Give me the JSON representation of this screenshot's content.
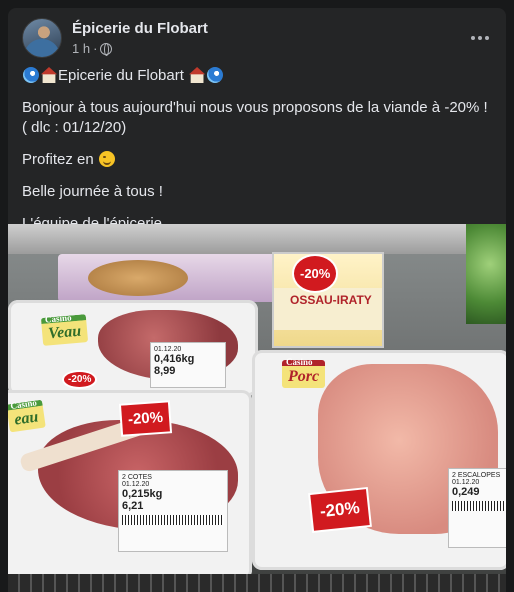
{
  "post": {
    "page_name": "Épicerie du Flobart",
    "time": "1 h",
    "time_separator": "·",
    "title_line": "Epicerie du Flobart",
    "message_line1": "Bonjour à tous aujourd'hui nous vous proposons de la viande à -20% ! ( dlc : 01/12/20)",
    "message_line2": "Profitez en",
    "message_line3": "Belle journée à tous !",
    "message_line4": "L'équipe de l'épicerie"
  },
  "photo": {
    "tag_veau": "Veau",
    "tag_veau_small": "Casino",
    "tag_veau_bot": "eau",
    "tag_porc": "Porc",
    "tag_porc_small": "Casino",
    "promo": "-20%",
    "cheese_label": "OSSAU-IRATY",
    "cheese_small": "Casino",
    "label_top_date": "01.12.20",
    "label_top_weight": "0,416kg",
    "label_top_price": "8,99",
    "label_bot_title": "2 COTES",
    "label_bot_date": "01.12.20",
    "label_bot_weight": "0,215kg",
    "label_bot_price": "6,21",
    "label_porc_title": "2 ESCALOPES",
    "label_porc_date": "01.12.20",
    "label_porc_weight": "0,249"
  },
  "icons": [
    "more-icon",
    "globe-icon",
    "wave-emoji",
    "house-emoji",
    "wink-emoji"
  ]
}
